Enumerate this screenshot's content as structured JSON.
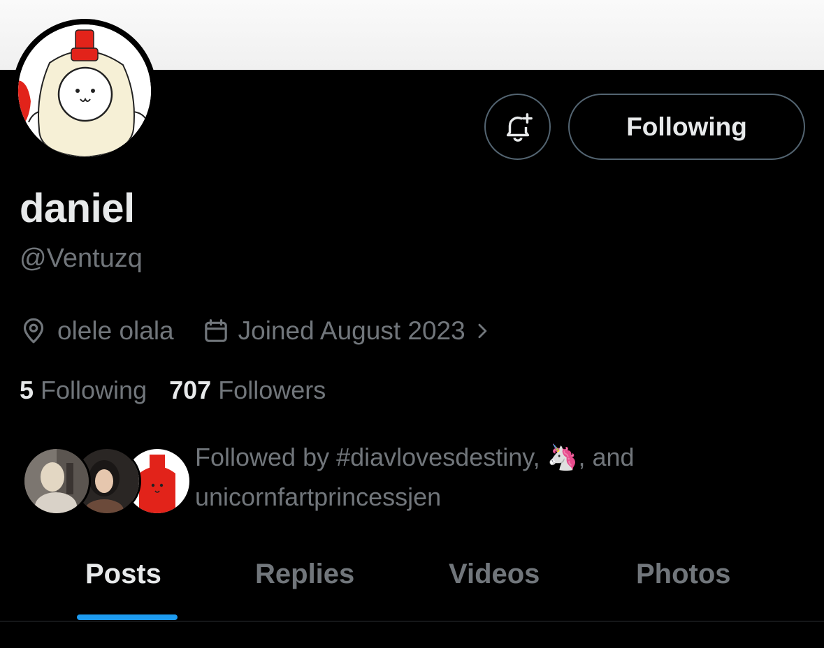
{
  "profile": {
    "display_name": "daniel",
    "handle": "@Ventuzq",
    "location": "olele olala",
    "joined": "Joined August 2023"
  },
  "actions": {
    "follow_state_label": "Following"
  },
  "stats": {
    "following_count": "5",
    "following_label": " Following",
    "followers_count": "707",
    "followers_label": " Followers"
  },
  "followed_by": {
    "text_prefix": "Followed by #diavlovesdestiny, ",
    "emoji": "🦄",
    "text_suffix": ", and",
    "last_name": "unicornfartprincessjen"
  },
  "tabs": [
    {
      "label": "Posts",
      "active": true
    },
    {
      "label": "Replies",
      "active": false
    },
    {
      "label": "Videos",
      "active": false
    },
    {
      "label": "Photos",
      "active": false
    }
  ],
  "colors": {
    "background": "#000000",
    "text_primary": "#e7e9ea",
    "text_secondary": "#71767b",
    "border": "#536471",
    "accent": "#1d9bf0"
  },
  "icons": {
    "location": "map-pin-icon",
    "calendar": "calendar-icon",
    "chevron": "chevron-right-icon",
    "notifications": "bell-plus-icon"
  }
}
